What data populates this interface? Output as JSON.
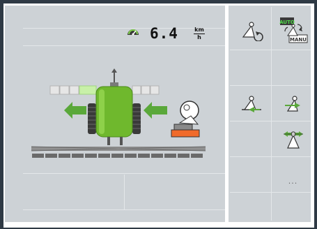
{
  "speed": {
    "value": "6.4",
    "unit_numerator": "km",
    "unit_denominator": "h"
  },
  "buttons": {
    "auto_mode": {
      "top": "AUTO",
      "bottom": "MANU"
    },
    "more_label": "..."
  },
  "colors": {
    "sprayer_green": "#6fb82d",
    "arrow_green": "#5aa83a",
    "accent_orange": "#f06a2a",
    "active_section": "#c8f0a8"
  },
  "section_bar": {
    "left_sections": 3,
    "active_sections": 1,
    "right_sections": 3
  }
}
